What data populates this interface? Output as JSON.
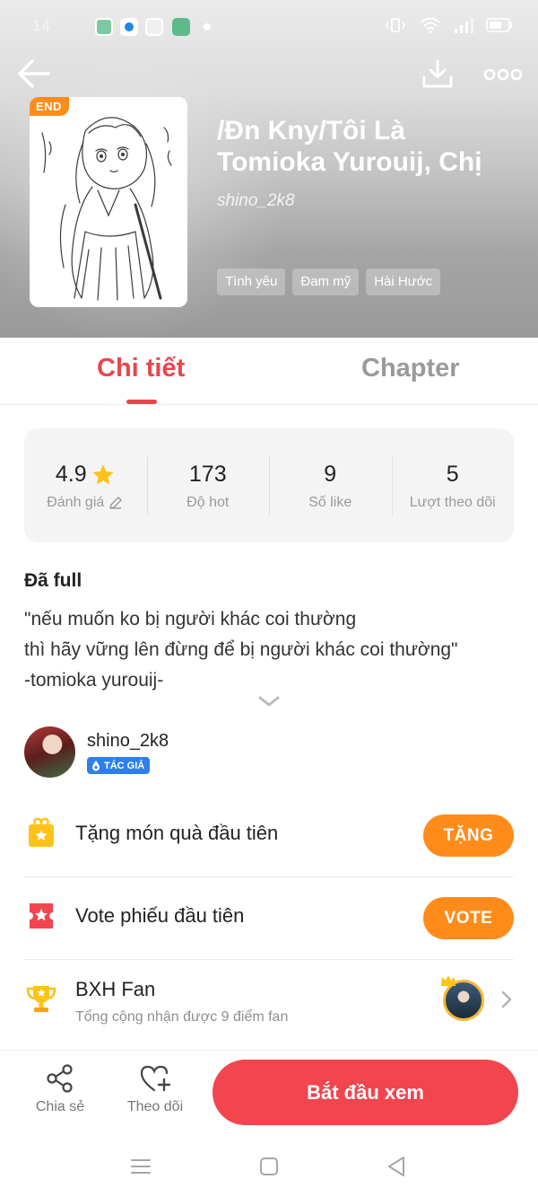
{
  "status_bar": {
    "time": "14"
  },
  "book": {
    "badge": "END",
    "title_line1": "/Đn Kny/Tôi Là",
    "title_line2": "Tomioka Yurouij, Chị",
    "author": "shino_2k8",
    "tags": [
      "Tình yêu",
      "Đam mỹ",
      "Hài Hước"
    ]
  },
  "tabs": [
    {
      "label": "Chi tiết",
      "active": true
    },
    {
      "label": "Chapter",
      "active": false
    }
  ],
  "stats": {
    "rating": {
      "value": "4.9",
      "label": "Đánh giá"
    },
    "hot": {
      "value": "173",
      "label": "Độ hot"
    },
    "likes": {
      "value": "9",
      "label": "Số like"
    },
    "followers": {
      "value": "5",
      "label": "Lượt theo dõi"
    }
  },
  "description": {
    "status": "Đã full",
    "lines": [
      "\"nếu muốn ko bị người khác coi thường",
      "thì hãy vững lên đừng để bị người khác coi thường\"",
      "-tomioka yurouij-"
    ]
  },
  "author_section": {
    "name": "shino_2k8",
    "role": "TÁC GIẢ"
  },
  "actions": {
    "gift": {
      "label": "Tặng món quà đầu tiên",
      "button": "TẶNG"
    },
    "vote": {
      "label": "Vote phiếu đầu tiên",
      "button": "VOTE"
    },
    "fan_ranking": {
      "label": "BXH Fan",
      "subtitle": "Tổng cộng nhận được 9 điểm fan"
    }
  },
  "bottom_bar": {
    "share": "Chia sẻ",
    "follow": "Theo dõi",
    "start": "Bắt đầu xem"
  },
  "colors": {
    "accent": "#e8464d",
    "orange": "#ff8c1a",
    "start_button": "#f2454e",
    "badge_blue": "#2f7fe8"
  }
}
